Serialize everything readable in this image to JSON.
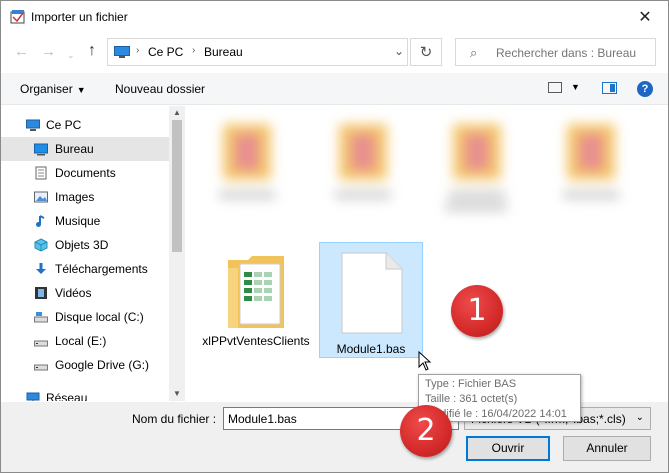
{
  "window": {
    "title": "Importer un fichier"
  },
  "nav": {
    "path": [
      "Ce PC",
      "Bureau"
    ],
    "search_placeholder": "Rechercher dans : Bureau"
  },
  "toolbar": {
    "organize": "Organiser",
    "new_folder": "Nouveau dossier"
  },
  "sidebar": {
    "items": [
      {
        "label": "Ce PC",
        "icon": "computer-icon"
      },
      {
        "label": "Bureau",
        "icon": "desktop-icon",
        "selected": true
      },
      {
        "label": "Documents",
        "icon": "documents-icon"
      },
      {
        "label": "Images",
        "icon": "images-icon"
      },
      {
        "label": "Musique",
        "icon": "music-icon"
      },
      {
        "label": "Objets 3D",
        "icon": "objects-3d-icon"
      },
      {
        "label": "Téléchargements",
        "icon": "downloads-icon"
      },
      {
        "label": "Vidéos",
        "icon": "videos-icon"
      },
      {
        "label": "Disque local (C:)",
        "icon": "drive-icon"
      },
      {
        "label": "Local (E:)",
        "icon": "drive-icon"
      },
      {
        "label": "Google Drive (G:)",
        "icon": "drive-icon"
      },
      {
        "label": "Réseau",
        "icon": "network-icon"
      }
    ]
  },
  "files": [
    {
      "name": "xlPPvtVentesClients",
      "kind": "folder"
    },
    {
      "name": "Module1.bas",
      "kind": "file",
      "selected": true
    }
  ],
  "tooltip": {
    "type": "Type : Fichier BAS",
    "size": "Taille : 361 octet(s)",
    "modified": "Modifié le : 16/04/2022 14:01"
  },
  "bottom": {
    "filename_label": "Nom du fichier :",
    "filename_value": "Module1.bas",
    "filter": "Fichiers VB (*.frm;*.bas;*.cls)",
    "open": "Ouvrir",
    "cancel": "Annuler"
  },
  "badges": [
    "1",
    "2"
  ],
  "colors": {
    "accent": "#0078d7",
    "selection": "#cce8ff",
    "badge": "#d42a2a"
  }
}
